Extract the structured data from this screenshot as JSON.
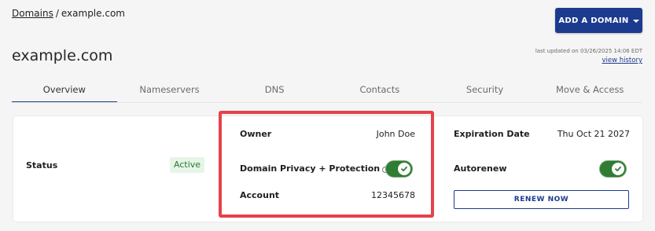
{
  "breadcrumb": {
    "root": "Domains",
    "separator": "/",
    "current": "example.com"
  },
  "header": {
    "add_domain_label": "ADD A DOMAIN",
    "title": "example.com",
    "last_updated": "last updated on 03/26/2025 14:06 EDT",
    "view_history": "view history"
  },
  "tabs": [
    {
      "label": "Overview",
      "active": true
    },
    {
      "label": "Nameservers"
    },
    {
      "label": "DNS"
    },
    {
      "label": "Contacts"
    },
    {
      "label": "Security"
    },
    {
      "label": "Move & Access"
    }
  ],
  "overview": {
    "status": {
      "label": "Status",
      "value": "Active"
    },
    "owner": {
      "label": "Owner",
      "value": "John Doe"
    },
    "privacy": {
      "label": "Domain Privacy + Protection",
      "info_icon": "i",
      "enabled": true
    },
    "account": {
      "label": "Account",
      "value": "12345678"
    },
    "expiration": {
      "label": "Expiration Date",
      "value": "Thu Oct 21 2027"
    },
    "autorenew": {
      "label": "Autorenew",
      "enabled": true
    },
    "renew_label": "RENEW NOW"
  },
  "colors": {
    "accent": "#1c3b8f",
    "toggle_on": "#2e7d32",
    "status_bg": "#e6f5e8",
    "status_text": "#257a2f",
    "highlight": "#e5424b"
  }
}
